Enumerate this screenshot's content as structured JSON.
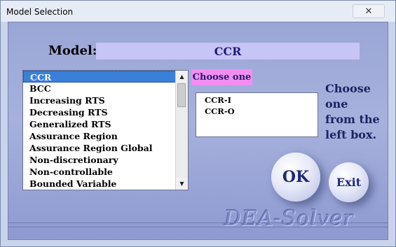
{
  "window": {
    "title": "Model Selection",
    "close_glyph": "✕"
  },
  "model": {
    "label": "Model:",
    "value": "CCR"
  },
  "model_list": {
    "items": [
      "CCR",
      "BCC",
      "Increasing RTS",
      "Decreasing RTS",
      "Generalized RTS",
      "Assurance Region",
      "Assurance Region Global",
      "Non-discretionary",
      "Non-controllable",
      "Bounded Variable"
    ],
    "selected": "CCR",
    "scroll_up": "▲",
    "scroll_down": "▼"
  },
  "variant": {
    "tag": "Choose one",
    "options": [
      "CCR-I",
      "CCR-O"
    ]
  },
  "instruction": [
    "Choose",
    "one",
    "from the",
    "left box."
  ],
  "buttons": {
    "ok": "OK",
    "exit": "Exit"
  },
  "logo": "DEA-Solver",
  "colors": {
    "client_bg": "#a6b1dd",
    "model_value_bg": "#c7c5f6",
    "choose_tag_bg": "#f28ef2",
    "selected_item_bg": "#3a7fd8",
    "text_navy": "#1e2a78"
  }
}
